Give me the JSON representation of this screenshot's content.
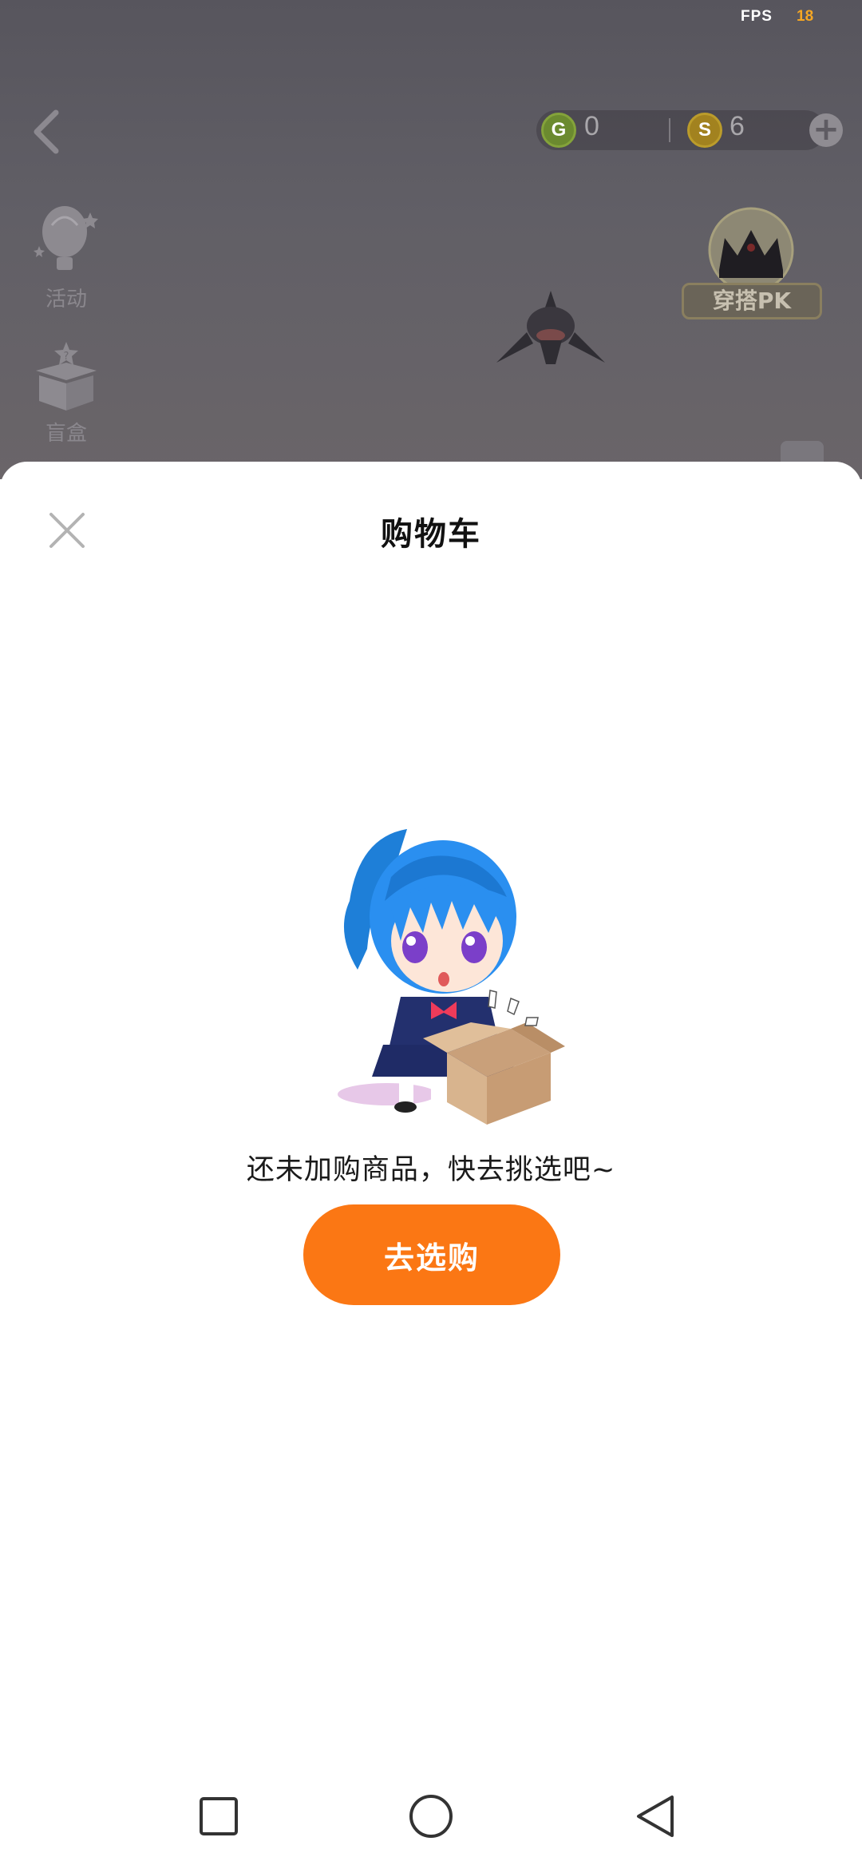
{
  "status": {
    "fps_label": "FPS",
    "fps_value": "18"
  },
  "game": {
    "currency_g_value": "0",
    "currency_s_value": "6",
    "currency_g_icon": "G",
    "currency_s_icon": "S",
    "side_entries": [
      {
        "label": "活动",
        "icon": "balloon-icon"
      },
      {
        "label": "盲盒",
        "icon": "blind-box-icon"
      }
    ],
    "pk_label": "穿搭PK"
  },
  "sheet": {
    "title": "购物车",
    "empty_message": "还未加购商品，快去挑选吧~",
    "shop_button_label": "去选购"
  },
  "colors": {
    "accent_orange": "#fb7714",
    "fps_value": "#f5a623",
    "overlay": "#5e5c63"
  }
}
